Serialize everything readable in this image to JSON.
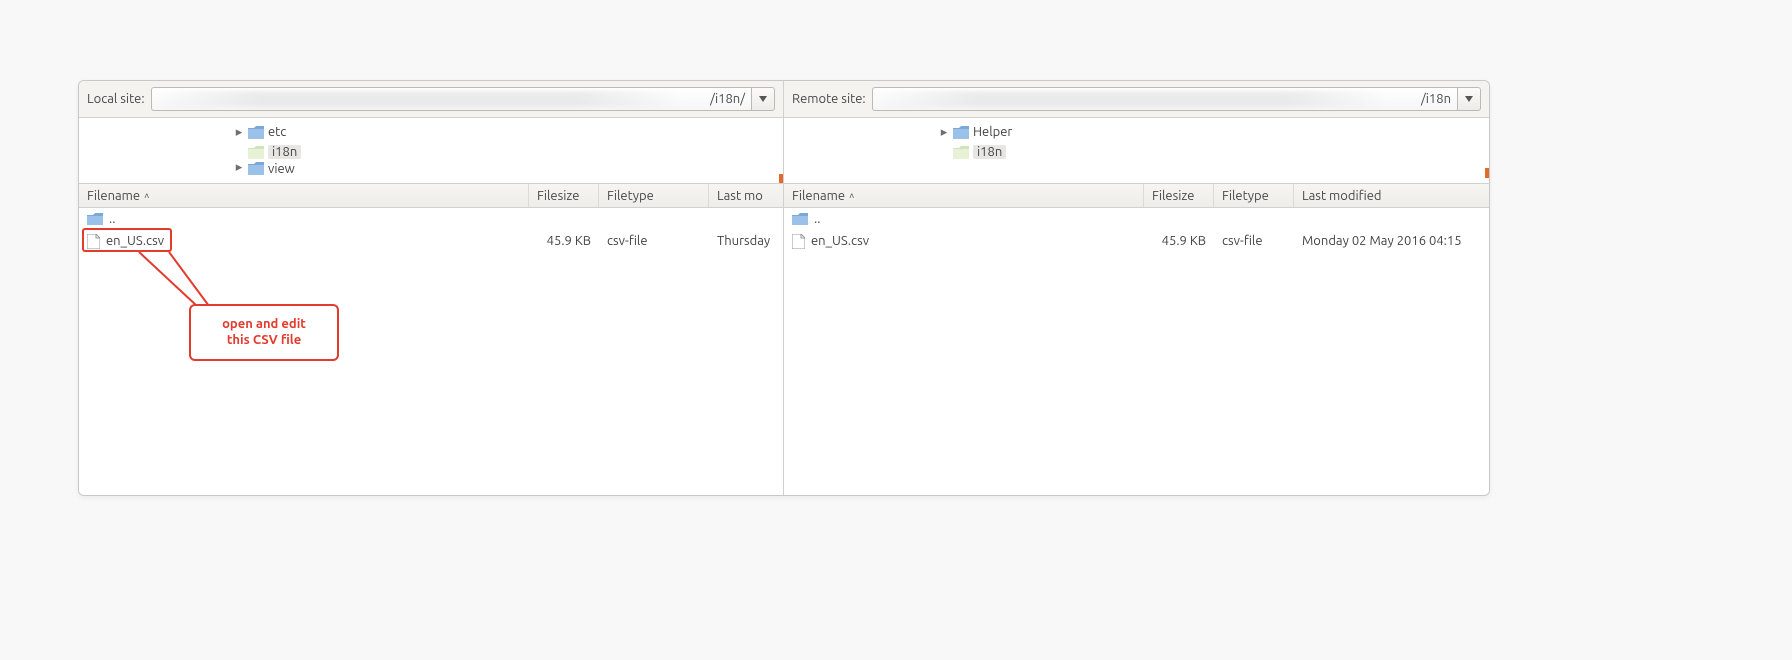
{
  "local": {
    "site_label": "Local site:",
    "path_tail": "/i18n/",
    "tree": [
      {
        "label": "etc",
        "expandable": true,
        "selected": false
      },
      {
        "label": "i18n",
        "expandable": false,
        "selected": true
      },
      {
        "label": "view",
        "expandable": true,
        "selected": false
      }
    ],
    "columns": {
      "name": "Filename",
      "size": "Filesize",
      "type": "Filetype",
      "modified": "Last mo"
    },
    "col_widths": {
      "name": 450,
      "size": 70,
      "type": 110,
      "modified": 72
    },
    "rows": [
      {
        "kind": "up",
        "name": ".."
      },
      {
        "kind": "file",
        "name": "en_US.csv",
        "size": "45.9 KB",
        "type": "csv-file",
        "modified": "Thursday"
      }
    ]
  },
  "remote": {
    "site_label": "Remote site:",
    "path_tail": "/i18n",
    "tree": [
      {
        "label": "Helper",
        "expandable": true,
        "selected": false
      },
      {
        "label": "i18n",
        "expandable": false,
        "selected": true
      }
    ],
    "columns": {
      "name": "Filename",
      "size": "Filesize",
      "type": "Filetype",
      "modified": "Last modified"
    },
    "col_widths": {
      "name": 360,
      "size": 70,
      "type": 80,
      "modified": 200
    },
    "rows": [
      {
        "kind": "up",
        "name": ".."
      },
      {
        "kind": "file",
        "name": "en_US.csv",
        "size": "45.9 KB",
        "type": "csv-file",
        "modified": "Monday 02 May 2016 04:15"
      }
    ]
  },
  "annotation": {
    "text_line1": "open and edit",
    "text_line2": "this CSV file"
  }
}
